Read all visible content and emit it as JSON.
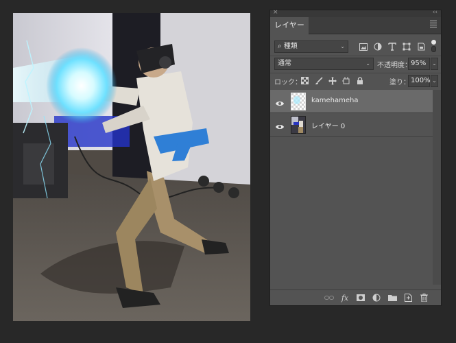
{
  "canvas": {
    "description": "image",
    "layer_image": "vr-kamehameha-photo"
  },
  "panel": {
    "tab_label": "レイヤー",
    "filter": {
      "kind_label": "種類",
      "icons": [
        "image-filter-icon",
        "adjustment-filter-icon",
        "type-filter-icon",
        "shape-filter-icon",
        "smart-object-filter-icon"
      ]
    },
    "blend_mode": "通常",
    "opacity_label": "不透明度：",
    "opacity_value": "95%",
    "lock_label": "ロック：",
    "fill_label": "塗り：",
    "fill_value": "100%",
    "layers": [
      {
        "name": "kamehameha",
        "visible": true,
        "selected": true
      },
      {
        "name": "レイヤー 0",
        "visible": true,
        "selected": false
      }
    ],
    "footer_icons": [
      "link-layers-icon",
      "fx-icon",
      "add-mask-icon",
      "adjustment-layer-icon",
      "group-folder-icon",
      "new-layer-icon",
      "trash-icon"
    ],
    "fx_label": "fx"
  },
  "colors": {
    "background": "#282828",
    "panel": "#535353",
    "selected_row": "#6a6a6a",
    "energy_blue": "#7ee8ff"
  }
}
